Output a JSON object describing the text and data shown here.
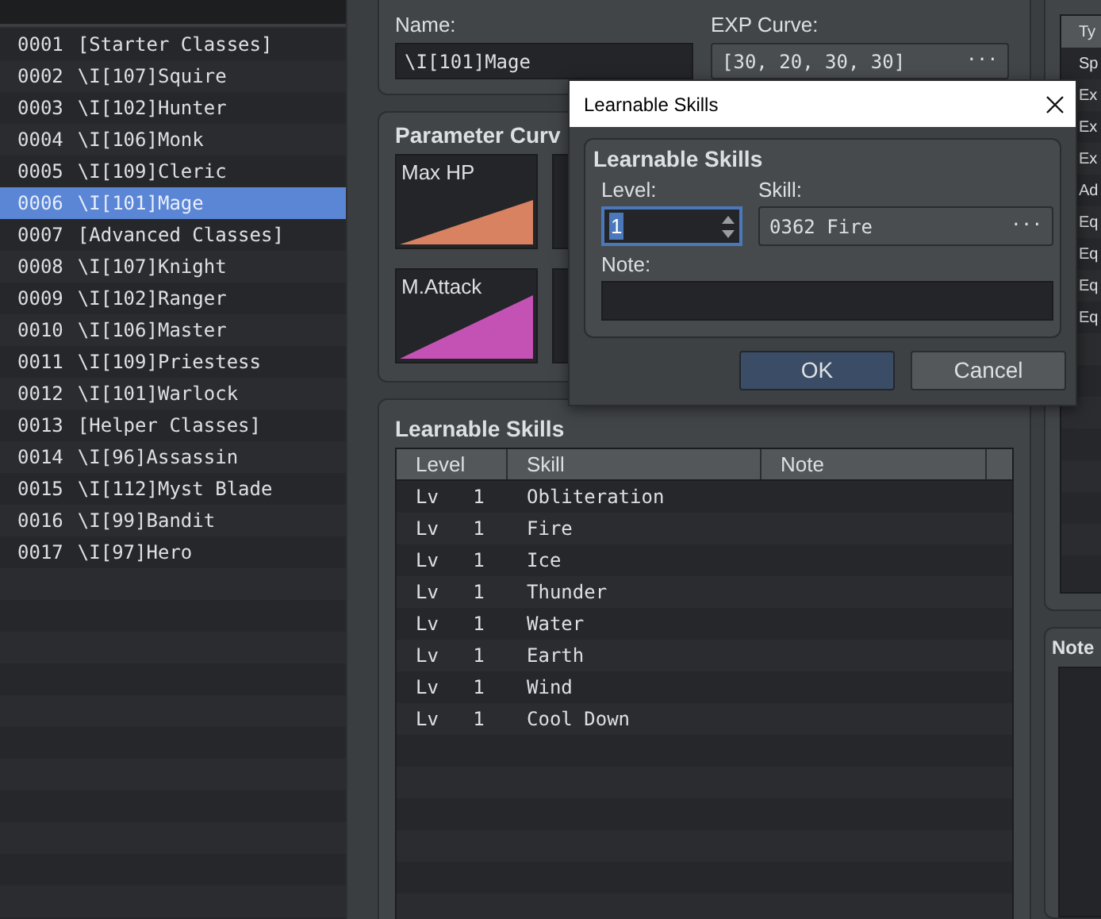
{
  "class_list": {
    "items": [
      {
        "id": "0001",
        "name": "[Starter Classes]",
        "selected": false
      },
      {
        "id": "0002",
        "name": "\\I[107]Squire",
        "selected": false
      },
      {
        "id": "0003",
        "name": "\\I[102]Hunter",
        "selected": false
      },
      {
        "id": "0004",
        "name": "\\I[106]Monk",
        "selected": false
      },
      {
        "id": "0005",
        "name": "\\I[109]Cleric",
        "selected": false
      },
      {
        "id": "0006",
        "name": "\\I[101]Mage",
        "selected": true
      },
      {
        "id": "0007",
        "name": "[Advanced Classes]",
        "selected": false
      },
      {
        "id": "0008",
        "name": "\\I[107]Knight",
        "selected": false
      },
      {
        "id": "0009",
        "name": "\\I[102]Ranger",
        "selected": false
      },
      {
        "id": "0010",
        "name": "\\I[106]Master",
        "selected": false
      },
      {
        "id": "0011",
        "name": "\\I[109]Priestess",
        "selected": false
      },
      {
        "id": "0012",
        "name": "\\I[101]Warlock",
        "selected": false
      },
      {
        "id": "0013",
        "name": "[Helper Classes]",
        "selected": false
      },
      {
        "id": "0014",
        "name": "\\I[96]Assassin",
        "selected": false
      },
      {
        "id": "0015",
        "name": "\\I[112]Myst Blade",
        "selected": false
      },
      {
        "id": "0016",
        "name": "\\I[99]Bandit",
        "selected": false
      },
      {
        "id": "0017",
        "name": "\\I[97]Hero",
        "selected": false
      }
    ]
  },
  "general": {
    "name_label": "Name:",
    "name_value": "\\I[101]Mage",
    "exp_label": "EXP Curve:",
    "exp_value": "[30, 20, 30, 30]",
    "exp_button": "···"
  },
  "parameter_curves": {
    "title": "Parameter Curv",
    "curves": [
      {
        "label": "Max HP",
        "color": "#d88262"
      },
      {
        "label": "M.Attack",
        "color": "#c452b4"
      }
    ]
  },
  "learnable_skills": {
    "title": "Learnable Skills",
    "columns": [
      "Level",
      "Skill",
      "Note"
    ],
    "rows": [
      {
        "level": "Lv   1",
        "skill": "Obliteration"
      },
      {
        "level": "Lv   1",
        "skill": "Fire"
      },
      {
        "level": "Lv   1",
        "skill": "Ice"
      },
      {
        "level": "Lv   1",
        "skill": "Thunder"
      },
      {
        "level": "Lv   1",
        "skill": "Water"
      },
      {
        "level": "Lv   1",
        "skill": "Earth"
      },
      {
        "level": "Lv   1",
        "skill": "Wind"
      },
      {
        "level": "Lv   1",
        "skill": "Cool Down"
      }
    ]
  },
  "traits": {
    "column_1": "Ty",
    "rows": [
      "Sp",
      "Ex",
      "Ex",
      "Ex",
      "Ad",
      "Eq",
      "Eq",
      "Eq",
      "Eq"
    ]
  },
  "note_panel": {
    "title": "Note"
  },
  "dialog": {
    "title": "Learnable Skills",
    "group_title": "Learnable Skills",
    "level_label": "Level:",
    "level_value": "1",
    "skill_label": "Skill:",
    "skill_value": "0362 Fire",
    "skill_button": "···",
    "note_label": "Note:",
    "buttons": [
      {
        "label": "OK",
        "kind": "primary"
      },
      {
        "label": "Cancel",
        "kind": "normal"
      }
    ]
  }
}
